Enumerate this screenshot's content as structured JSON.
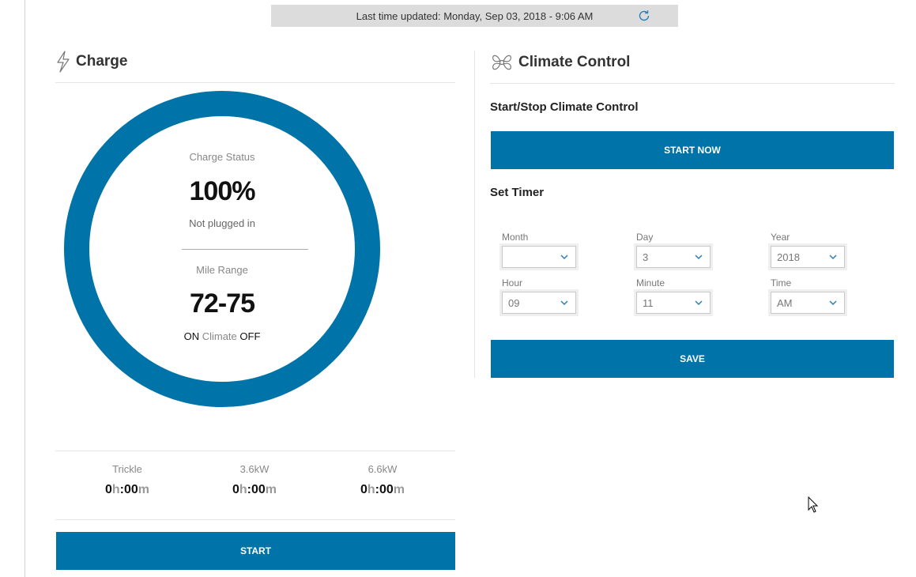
{
  "update_bar": {
    "text": "Last time updated: Monday, Sep 03, 2018 - 9:06 AM"
  },
  "charge": {
    "title": "Charge",
    "status_label": "Charge Status",
    "percent": "100%",
    "plug_status": "Not plugged in",
    "range_label": "Mile Range",
    "range": "72-75",
    "climate_on": "ON",
    "climate_word": "Climate",
    "climate_off": "OFF",
    "timings": [
      {
        "label": "Trickle",
        "h": "0",
        "hu": "h",
        "sep": ":",
        "m": "00",
        "mu": "m"
      },
      {
        "label": "3.6kW",
        "h": "0",
        "hu": "h",
        "sep": ":",
        "m": "00",
        "mu": "m"
      },
      {
        "label": "6.6kW",
        "h": "0",
        "hu": "h",
        "sep": ":",
        "m": "00",
        "mu": "m"
      }
    ],
    "start_button": "START"
  },
  "climate": {
    "title": "Climate Control",
    "start_stop_title": "Start/Stop Climate Control",
    "start_now_button": "START NOW",
    "timer_title": "Set Timer",
    "fields": {
      "month": {
        "label": "Month",
        "value": ""
      },
      "day": {
        "label": "Day",
        "value": "3"
      },
      "year": {
        "label": "Year",
        "value": "2018"
      },
      "hour": {
        "label": "Hour",
        "value": "09"
      },
      "minute": {
        "label": "Minute",
        "value": "11"
      },
      "time": {
        "label": "Time",
        "value": "AM"
      }
    },
    "save_button": "SAVE"
  },
  "colors": {
    "accent": "#0073a8",
    "bar": "#dcdcdc"
  },
  "icons": [
    "refresh-icon",
    "lightning-icon",
    "fan-icon",
    "chevron-down-icon"
  ]
}
